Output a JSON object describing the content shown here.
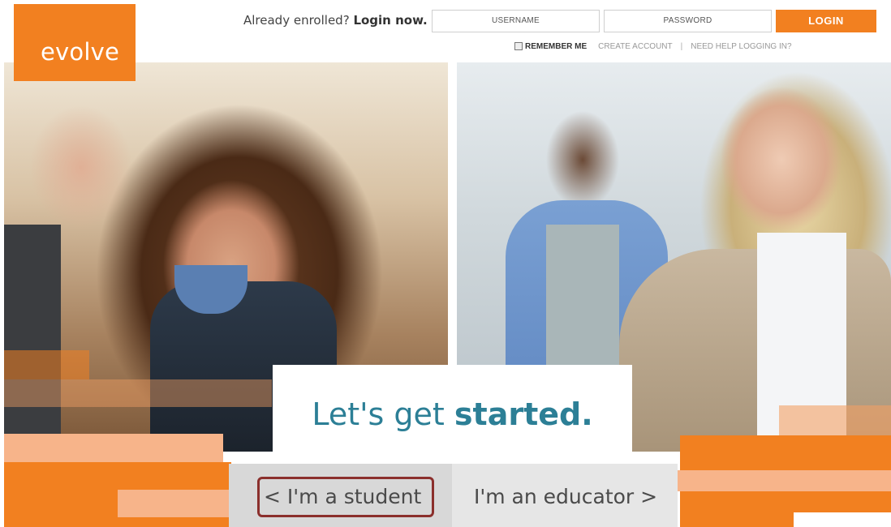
{
  "header": {
    "logo_text": "evolve",
    "enrolled_prefix": "Already enrolled?",
    "enrolled_link": "Login now.",
    "username_placeholder": "USERNAME",
    "password_placeholder": "PASSWORD",
    "login_button": "LOGIN",
    "remember_me": "REMEMBER ME",
    "create_account": "CREATE ACCOUNT",
    "separator": "|",
    "need_help": "NEED HELP LOGGING IN?"
  },
  "hero": {
    "headline_prefix": "Let's get ",
    "headline_strong": "started."
  },
  "choices": {
    "student": "< I'm a student",
    "educator": "I'm an educator >"
  },
  "colors": {
    "brand_orange": "#f28020",
    "headline_teal": "#2c7f96",
    "highlight_border": "#8b2f2c"
  }
}
